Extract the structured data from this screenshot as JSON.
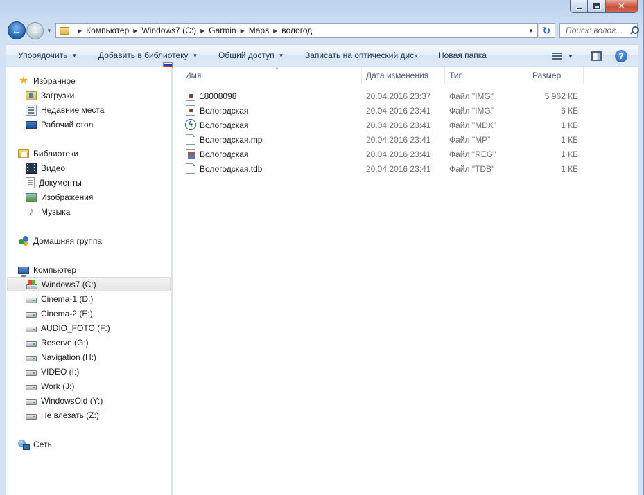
{
  "window": {
    "caption": {
      "minimize_icon": "minimize-icon",
      "maximize_icon": "maximize-icon",
      "close_glyph": "✕"
    }
  },
  "navigation": {
    "back_glyph": "←",
    "forward_glyph": "→",
    "history_glyph": "▼",
    "breadcrumbs": [
      "Компьютер",
      "Windows7 (C:)",
      "Garmin",
      "Maps",
      "вологод"
    ],
    "separator_glyph": "▶",
    "dropdown_glyph": "▼",
    "refresh_glyph": "↻",
    "search_placeholder": "Поиск: волог..."
  },
  "command_bar": {
    "organize": "Упорядочить",
    "add_to_library": "Добавить в библиотеку",
    "share": "Общий доступ",
    "burn": "Записать на оптический диск",
    "new_folder": "Новая папка",
    "dropdown_glyph": "▼",
    "help_glyph": "?"
  },
  "sidebar": {
    "favorites": {
      "label": "Избранное",
      "items": [
        {
          "label": "Загрузки",
          "icon": "downloads-icon"
        },
        {
          "label": "Недавние места",
          "icon": "recent-places-icon"
        },
        {
          "label": "Рабочий стол",
          "icon": "desktop-icon"
        }
      ]
    },
    "libraries": {
      "label": "Библиотеки",
      "items": [
        {
          "label": "Видео",
          "icon": "video-icon"
        },
        {
          "label": "Документы",
          "icon": "documents-icon"
        },
        {
          "label": "Изображения",
          "icon": "pictures-icon"
        },
        {
          "label": "Музыка",
          "icon": "music-icon"
        }
      ]
    },
    "homegroup": {
      "label": "Домашняя группа"
    },
    "computer": {
      "label": "Компьютер",
      "selected": "Windows7 (C:)",
      "drives": [
        "Windows7 (C:)",
        "Cinema-1 (D:)",
        "Cinema-2 (E:)",
        "AUDIO_FOTO (F:)",
        "Reserve (G:)",
        "Navigation (H:)",
        "VIDEO (I:)",
        "Work (J:)",
        "WindowsOld (Y:)",
        "Не влезать (Z:)"
      ]
    },
    "network": {
      "label": "Сеть"
    }
  },
  "file_list": {
    "columns": {
      "name": "Имя",
      "date": "Дата изменения",
      "type": "Тип",
      "size": "Размер"
    },
    "sort_glyph": "▲",
    "rows": [
      {
        "name": "18008098",
        "date": "20.04.2016 23:37",
        "type": "Файл \"IMG\"",
        "size": "5 962 КБ",
        "icon": "img-file-icon"
      },
      {
        "name": "Вологодская",
        "date": "20.04.2016 23:41",
        "type": "Файл \"IMG\"",
        "size": "6 КБ",
        "icon": "img-file-icon"
      },
      {
        "name": "Вологодская",
        "date": "20.04.2016 23:41",
        "type": "Файл \"MDX\"",
        "size": "1 КБ",
        "icon": "mdx-file-icon"
      },
      {
        "name": "Вологодская.mp",
        "date": "20.04.2016 23:41",
        "type": "Файл \"MP\"",
        "size": "1 КБ",
        "icon": "blank-file-icon"
      },
      {
        "name": "Вологодская",
        "date": "20.04.2016 23:41",
        "type": "Файл \"REG\"",
        "size": "1 КБ",
        "icon": "reg-file-icon"
      },
      {
        "name": "Вологодская.tdb",
        "date": "20.04.2016 23:41",
        "type": "Файл \"TDB\"",
        "size": "1 КБ",
        "icon": "blank-file-icon"
      }
    ]
  }
}
